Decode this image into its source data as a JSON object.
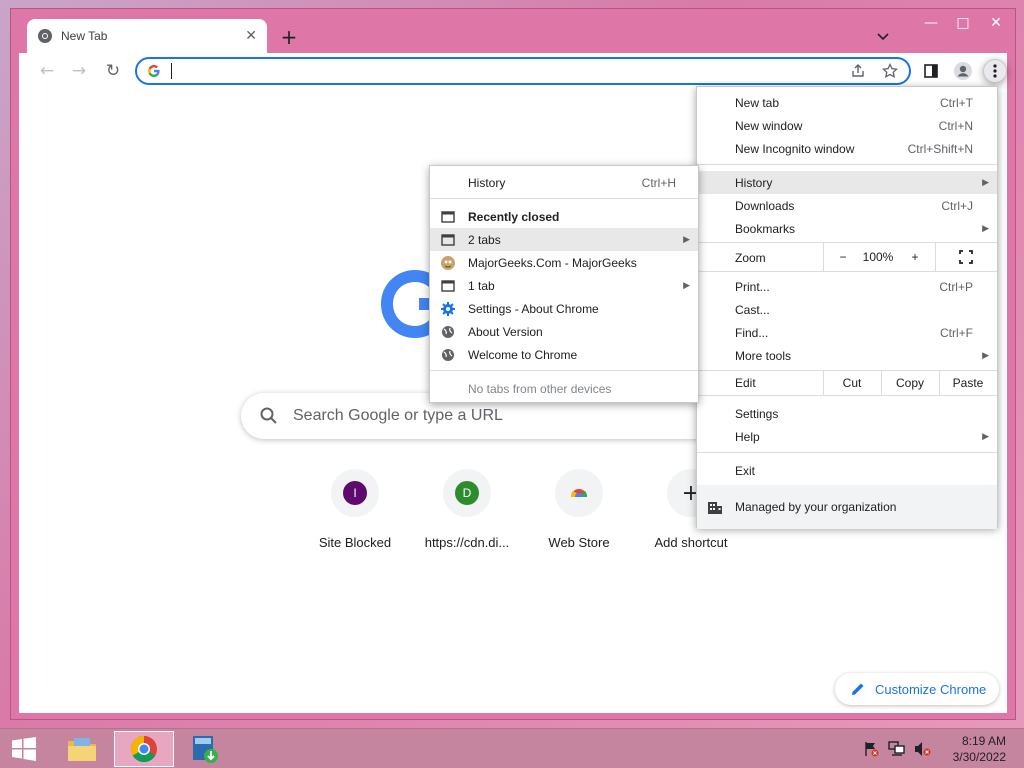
{
  "window": {
    "controls": {
      "minimize": "—",
      "maximize": "□",
      "close": "✕"
    }
  },
  "tab": {
    "title": "New Tab",
    "close": "✕",
    "favicon": "chrome-icon"
  },
  "tabstrip": {
    "new_tab": "+",
    "tab_search": "⌄"
  },
  "toolbar": {
    "back": "←",
    "forward": "→",
    "reload": "↻",
    "address_value": "",
    "icons": [
      "google-g-icon",
      "share-icon",
      "bookmark-star-icon",
      "side-panel-icon",
      "profile-icon",
      "kebab-menu-icon"
    ]
  },
  "ntp": {
    "search_placeholder": "Search Google or type a URL",
    "shortcuts": [
      {
        "label": "Site Blocked",
        "initial": "I",
        "color": "#5c0a6d"
      },
      {
        "label": "https://cdn.di...",
        "initial": "D",
        "color": "#2e8b2e"
      },
      {
        "label": "Web Store",
        "initial": "",
        "color": "#ffffff"
      },
      {
        "label": "Add shortcut",
        "initial": "+",
        "color": "#f1f3f4"
      }
    ],
    "customize": "Customize Chrome"
  },
  "main_menu": {
    "new_tab": {
      "label": "New tab",
      "accel": "Ctrl+T"
    },
    "new_window": {
      "label": "New window",
      "accel": "Ctrl+N"
    },
    "incognito": {
      "label": "New Incognito window",
      "accel": "Ctrl+Shift+N"
    },
    "history": {
      "label": "History"
    },
    "downloads": {
      "label": "Downloads",
      "accel": "Ctrl+J"
    },
    "bookmarks": {
      "label": "Bookmarks"
    },
    "zoom": {
      "label": "Zoom",
      "minus": "−",
      "value": "100%",
      "plus": "+"
    },
    "print": {
      "label": "Print...",
      "accel": "Ctrl+P"
    },
    "cast": {
      "label": "Cast..."
    },
    "find": {
      "label": "Find...",
      "accel": "Ctrl+F"
    },
    "more_tools": {
      "label": "More tools"
    },
    "edit": {
      "label": "Edit",
      "cut": "Cut",
      "copy": "Copy",
      "paste": "Paste"
    },
    "settings": {
      "label": "Settings"
    },
    "help": {
      "label": "Help"
    },
    "exit": {
      "label": "Exit"
    },
    "managed": {
      "label": "Managed by your organization"
    }
  },
  "history_menu": {
    "history": {
      "label": "History",
      "accel": "Ctrl+H"
    },
    "recently_closed": "Recently closed",
    "items": [
      {
        "label": "2 tabs",
        "icon": "window-icon",
        "submenu": true
      },
      {
        "label": "MajorGeeks.Com - MajorGeeks",
        "icon": "majorgeeks-favicon",
        "submenu": false
      },
      {
        "label": "1 tab",
        "icon": "window-icon",
        "submenu": true
      },
      {
        "label": "Settings - About Chrome",
        "icon": "settings-gear-icon",
        "submenu": false
      },
      {
        "label": "About Version",
        "icon": "globe-icon",
        "submenu": false
      },
      {
        "label": "Welcome to Chrome",
        "icon": "globe-icon",
        "submenu": false
      }
    ],
    "no_tabs": "No tabs from other devices"
  },
  "taskbar": {
    "time": "8:19 AM",
    "date": "3/30/2022"
  },
  "colors": {
    "accent": "#1a73e8",
    "frame": "#de76a7",
    "menu_highlight": "#e8e8e8"
  }
}
